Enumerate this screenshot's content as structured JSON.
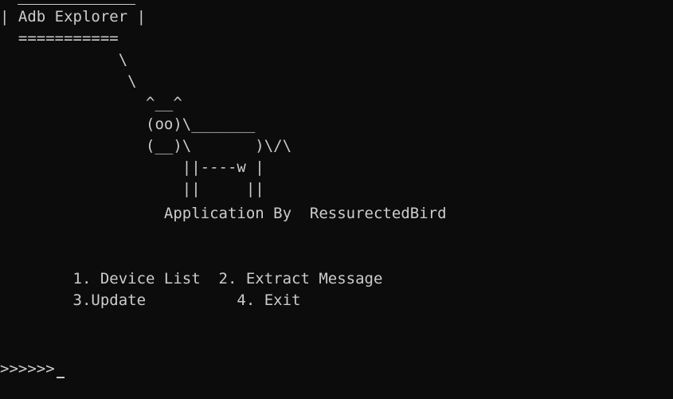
{
  "terminal": {
    "banner": {
      "title_line": "| Adb Explorer |",
      "underline": "  ===========",
      "tail_1": "             \\",
      "tail_2": "              \\",
      "cow_ears": "                ^__^",
      "cow_face": "                (oo)\\_______",
      "cow_body": "                (__)\\       )\\/\\",
      "cow_legs_1": "                    ||----w |",
      "cow_legs_2": "                    ||     ||",
      "credit": "                  Application By  RessurectedBird"
    },
    "menu": {
      "row_1": "        1. Device List  2. Extract Message",
      "row_2": "        3.Update          4. Exit"
    },
    "prompt": ">>>>>>"
  },
  "colors": {
    "background": "#0c0c0c",
    "foreground": "#cccccc"
  }
}
